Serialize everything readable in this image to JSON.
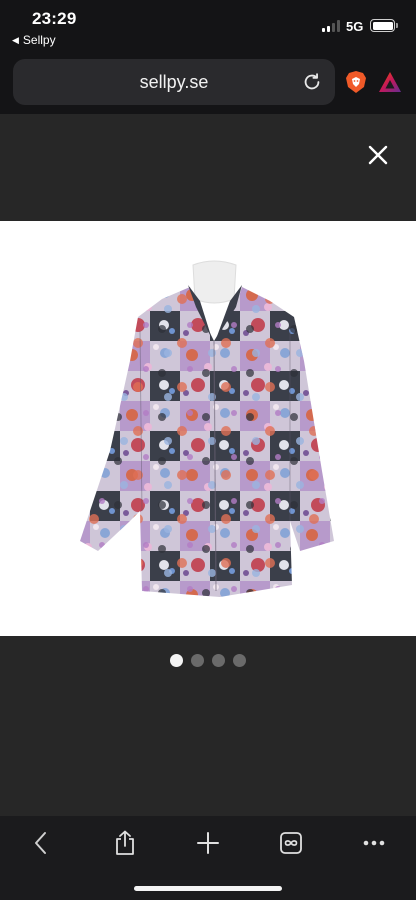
{
  "status_bar": {
    "time": "23:29",
    "back_app": "Sellpy",
    "network": "5G",
    "signal_bars": 2
  },
  "browser": {
    "url": "sellpy.se"
  },
  "gallery": {
    "image_count": 4,
    "active_index": 0,
    "photo_description_icon": "patterned-blouse-on-mannequin"
  },
  "colors": {
    "background": "#141416",
    "page": "#272727",
    "accent_brave": "#f05a28"
  }
}
